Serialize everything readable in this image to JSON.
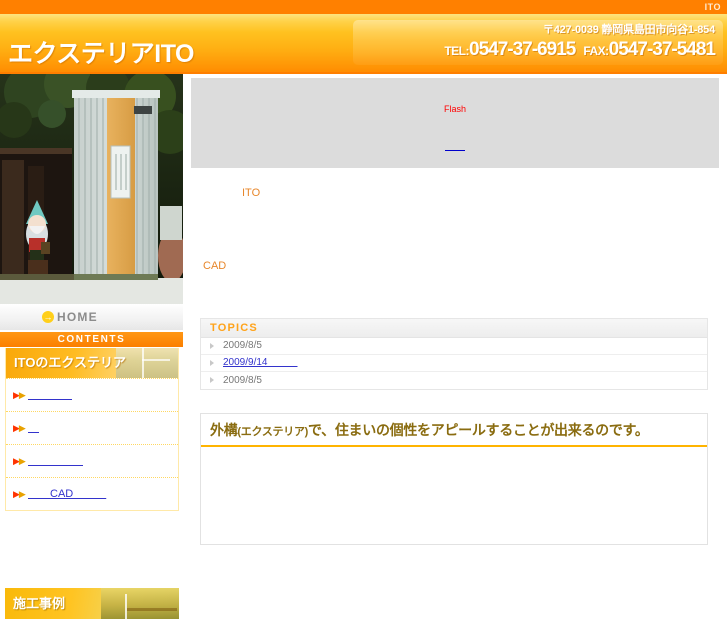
{
  "topbar": {
    "site_tag": "ITO"
  },
  "header": {
    "logo": "エクステリアITO",
    "postal_address": "〒427-0039 静岡県島田市向谷1-854",
    "tel_label": "TEL:",
    "tel_number": "0547-37-6915",
    "fax_label": "FAX:",
    "fax_number": "0547-37-5481",
    "accent_color": "#ff8000"
  },
  "sidebar": {
    "home_label": "HOME",
    "home_arrow": "→",
    "contents_label": "CONTENTS",
    "menu_banner_label": "ITOのエクステリア",
    "menu_items": [
      {
        "label": "　　　　"
      },
      {
        "label": "　"
      },
      {
        "label": "　　　　　"
      },
      {
        "label": "　　CAD　　　"
      }
    ],
    "second_banner_label": "施工事例"
  },
  "main": {
    "flash": {
      "placeholder_label": "Flash",
      "link_label": "　　"
    },
    "intro": {
      "line1": "ITO",
      "line2": "CAD"
    },
    "topics": {
      "heading": "TOPICS",
      "rows": [
        {
          "text": "2009/8/5",
          "is_link": false
        },
        {
          "text": "2009/9/14　　　",
          "is_link": true
        },
        {
          "text": "2009/8/5",
          "is_link": false
        }
      ]
    },
    "message": {
      "prefix": "外構",
      "paren": "(エクステリア)",
      "rest": "で、住まいの個性をアピールすることが出来るのです。"
    }
  }
}
